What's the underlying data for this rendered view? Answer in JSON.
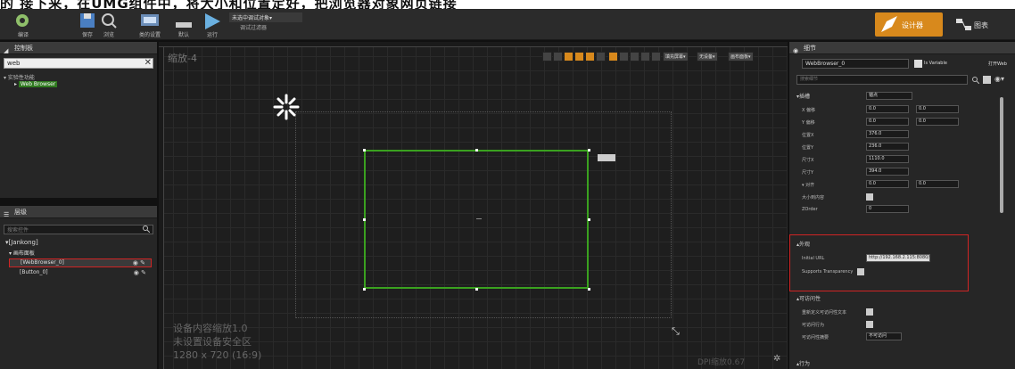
{
  "caption": "的 接下来，在UMG组件中，将大小和位置定好，把浏览器对象网页链接",
  "toolbar": {
    "buttons": [
      {
        "label": "编译",
        "icon": "compile-icon"
      },
      {
        "label": "保存",
        "icon": "save-icon"
      },
      {
        "label": "浏览",
        "icon": "browse-icon"
      },
      {
        "label": "类的设置",
        "icon": "class-settings-icon"
      },
      {
        "label": "默认",
        "icon": "defaults-icon"
      },
      {
        "label": "运行",
        "icon": "play-icon"
      }
    ],
    "debug_filter": {
      "label": "未选中调试对象▾",
      "sub": "调试过滤器"
    },
    "designer": "设计器",
    "graph": "图表"
  },
  "palette": {
    "title": "控制板",
    "search_value": "web",
    "category": "▾ 实验性功能",
    "item": "Web Browser"
  },
  "hierarchy": {
    "title": "层级",
    "search_placeholder": "搜索控件",
    "root": "▾[Jankong]",
    "rows": [
      {
        "label": "▾ 画布面板",
        "highlighted": false
      },
      {
        "label": "[WebBrowser_0]",
        "highlighted": true
      },
      {
        "label": "[Button_0]",
        "highlighted": false
      }
    ]
  },
  "viewport": {
    "zoom": "缩放-4",
    "notes": [
      "设备内容缩放1.0",
      "未设置设备安全区",
      "1280 x 720 (16:9)"
    ],
    "dpi": "DPI缩放0.67",
    "tools": [
      "填充屏幕▾",
      "无设备▾",
      "画布面板▾"
    ]
  },
  "details": {
    "title": "细节",
    "name_value": "WebBrowser_0",
    "is_variable": "Is Variable",
    "open_label": "打开Web",
    "search_placeholder": "搜索细节",
    "slot_section": "▾插槽",
    "anchor_label": "锚点",
    "anchor_value": "锚点",
    "rows": [
      {
        "label": "X 偏移",
        "values": [
          "0.0",
          "0.0"
        ]
      },
      {
        "label": "Y 偏移",
        "values": [
          "0.0",
          "0.0"
        ]
      },
      {
        "label": "位置X",
        "values": [
          "376.0"
        ]
      },
      {
        "label": "位置Y",
        "values": [
          "236.0"
        ]
      },
      {
        "label": "尺寸X",
        "values": [
          "1110.0"
        ]
      },
      {
        "label": "尺寸Y",
        "values": [
          "394.0"
        ]
      }
    ],
    "alignment_label": "▾ 对齐",
    "alignment_values": [
      "0.0",
      "0.0"
    ],
    "size_to_content": "大小到内容",
    "zorder": "ZOrder",
    "zorder_value": "0",
    "appearance_section": "▴外观",
    "initial_url_label": "Initial URL",
    "initial_url_value": "http://192.168.2.115:8080/",
    "supports_transparency": "Supports Transparency",
    "accessibility_section": "▴可访问性",
    "access_rows": [
      {
        "label": "重新定义可访问性文本"
      },
      {
        "label": "可访问行为"
      },
      {
        "label": "可访问性摘要"
      }
    ],
    "access_value": "不可访问",
    "bottom_section": "▴行为"
  },
  "colors": {
    "accent": "#d8891c",
    "selection": "#3aa11f",
    "highlight_red": "#d02424"
  }
}
